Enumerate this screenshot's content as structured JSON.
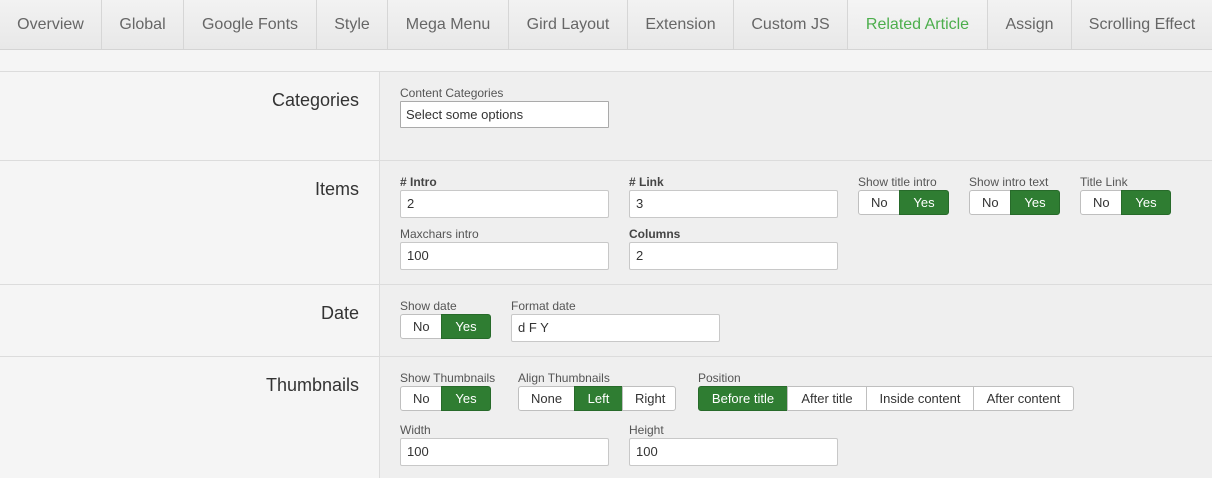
{
  "tabs": [
    {
      "label": "Overview"
    },
    {
      "label": "Global"
    },
    {
      "label": "Google Fonts"
    },
    {
      "label": "Style"
    },
    {
      "label": "Mega Menu"
    },
    {
      "label": "Gird Layout"
    },
    {
      "label": "Extension"
    },
    {
      "label": "Custom JS"
    },
    {
      "label": "Related Article",
      "active": true
    },
    {
      "label": "Assign"
    },
    {
      "label": "Scrolling Effect"
    }
  ],
  "colors": {
    "active_tab": "#4cae4c",
    "toggle_on": "#2f7d32"
  },
  "categories": {
    "title": "Categories",
    "content_categories": {
      "label": "Content Categories",
      "placeholder": "Select some options"
    }
  },
  "items": {
    "title": "Items",
    "intro": {
      "label": "# Intro",
      "value": "2"
    },
    "link": {
      "label": "# Link",
      "value": "3"
    },
    "show_title_intro": {
      "label": "Show title intro",
      "no": "No",
      "yes": "Yes",
      "selected": "Yes"
    },
    "show_intro_text": {
      "label": "Show intro text",
      "no": "No",
      "yes": "Yes",
      "selected": "Yes"
    },
    "title_link": {
      "label": "Title Link",
      "no": "No",
      "yes": "Yes",
      "selected": "Yes"
    },
    "maxchars_intro": {
      "label": "Maxchars intro",
      "value": "100"
    },
    "columns": {
      "label": "Columns",
      "value": "2"
    }
  },
  "date": {
    "title": "Date",
    "show_date": {
      "label": "Show date",
      "no": "No",
      "yes": "Yes",
      "selected": "Yes"
    },
    "format_date": {
      "label": "Format date",
      "value": "d F Y"
    }
  },
  "thumbnails": {
    "title": "Thumbnails",
    "show_thumbnails": {
      "label": "Show Thumbnails",
      "no": "No",
      "yes": "Yes",
      "selected": "Yes"
    },
    "align_thumbnails": {
      "label": "Align Thumbnails",
      "options": [
        "None",
        "Left",
        "Right"
      ],
      "selected": "Left"
    },
    "position": {
      "label": "Position",
      "options": [
        "Before title",
        "After title",
        "Inside content",
        "After content"
      ],
      "selected": "Before title"
    },
    "width": {
      "label": "Width",
      "value": "100"
    },
    "height": {
      "label": "Height",
      "value": "100"
    }
  }
}
